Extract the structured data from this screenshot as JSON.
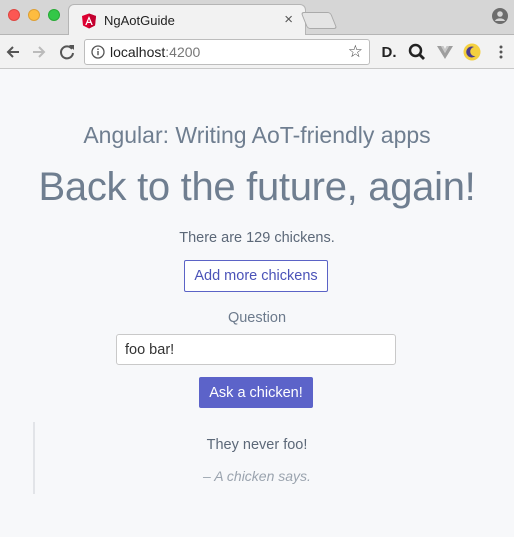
{
  "browser": {
    "tab_title": "NgAotGuide",
    "tab_close": "×",
    "url_host": "localhost",
    "url_port": ":4200",
    "icons": [
      "angular-icon",
      "back-arrow-icon",
      "forward-arrow-icon",
      "reload-icon",
      "info-icon",
      "star-icon",
      "profile-icon"
    ],
    "extensions": [
      {
        "name": "extension-d-icon",
        "glyph": "D."
      },
      {
        "name": "extension-magnify-icon",
        "glyph": "Q"
      },
      {
        "name": "extension-vue-icon",
        "glyph": "V"
      },
      {
        "name": "extension-moon-icon",
        "glyph": "☾"
      },
      {
        "name": "menu-icon",
        "glyph": "⋮"
      }
    ]
  },
  "page": {
    "subtitle": "Angular: Writing AoT-friendly apps",
    "headline": "Back to the future, again!",
    "chicken_count": "There are 129 chickens.",
    "add_button": "Add more chickens",
    "question_label": "Question",
    "question_value": "foo bar!",
    "ask_button": "Ask a chicken!",
    "answer": "They never foo!",
    "attribution": "– A chicken says."
  },
  "colors": {
    "accent": "#5c63c9",
    "text": "#6f7e90",
    "angular_red": "#dd0031"
  }
}
